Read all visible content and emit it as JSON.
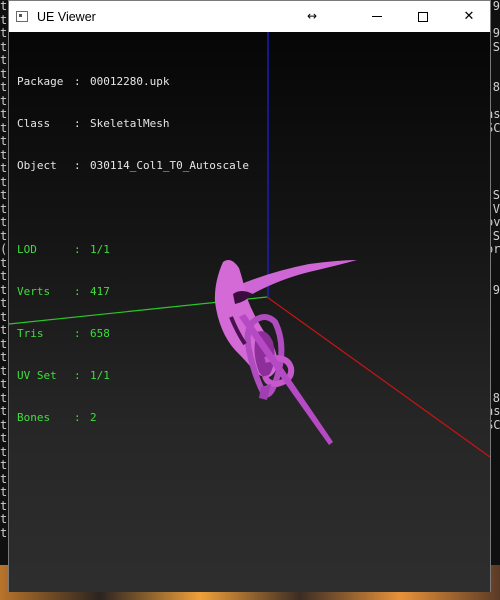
{
  "window": {
    "title": "UE Viewer",
    "move_glyph": "↔",
    "icon": "app-window-icon",
    "controls": {
      "minimize": "minimize-icon",
      "maximize": "maximize-icon",
      "close_glyph": "✕"
    }
  },
  "info": {
    "package": {
      "label": "Package",
      "sep": ":",
      "value": "00012280.upk"
    },
    "class": {
      "label": "Class",
      "sep": ":",
      "value": "SkeletalMesh"
    },
    "object": {
      "label": "Object",
      "sep": ":",
      "value": "030114_Col1_T0_Autoscale"
    },
    "lod": {
      "label": "LOD",
      "sep": ":",
      "value": "1/1"
    },
    "verts": {
      "label": "Verts",
      "sep": ":",
      "value": "417"
    },
    "tris": {
      "label": "Tris",
      "sep": ":",
      "value": "658"
    },
    "uvset": {
      "label": "UV Set",
      "sep": ":",
      "value": "1/1"
    },
    "bones": {
      "label": "Bones",
      "sep": ":",
      "value": "2"
    }
  },
  "colors": {
    "info_white": "#e6e6e6",
    "info_green": "#3ede3e",
    "axis_x": "#c81414",
    "axis_y": "#28c828",
    "axis_z": "#2020d0",
    "mesh": "#d36ad6"
  },
  "background": {
    "left_column": "t\nt\nt\nt\nt\nt\nt\nt\nt\nt\nt\nt\nt\nt\nt\nt\nt\nt\n(\nt\nt\nt\nt\nt\nt\nt\nt\nt\nt\nt\nt\nt\nt\nt\nt\nt\nt\nt\nt\nt",
    "right_column": "9\n\n9\nS\n\n\n8\n\nas\nSC\n\n\n\n\nS\nV\nov\nS\nor\n\n\n9\n\n\n\n\n\n\n\n8\nas\nSC"
  }
}
